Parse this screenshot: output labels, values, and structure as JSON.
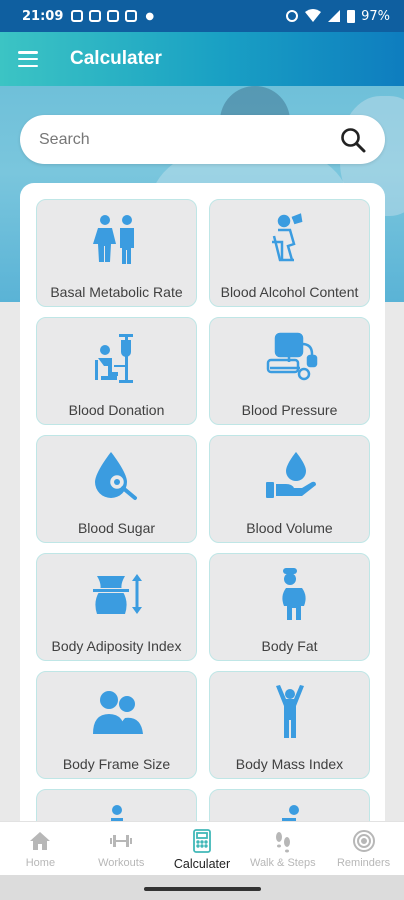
{
  "status_bar": {
    "time": "21:09",
    "battery": "97%"
  },
  "app_bar": {
    "title": "Calculater"
  },
  "search": {
    "placeholder": "Search"
  },
  "tiles": [
    {
      "label": "Basal Metabolic Rate",
      "icon": "couple-icon"
    },
    {
      "label": "Blood Alcohol Content",
      "icon": "drinking-person-icon"
    },
    {
      "label": "Blood Donation",
      "icon": "blood-donation-icon"
    },
    {
      "label": "Blood Pressure",
      "icon": "blood-pressure-monitor-icon"
    },
    {
      "label": "Blood Sugar",
      "icon": "blood-drop-search-icon"
    },
    {
      "label": "Blood Volume",
      "icon": "hand-drop-icon"
    },
    {
      "label": "Body Adiposity Index",
      "icon": "waist-measure-icon"
    },
    {
      "label": "Body Fat",
      "icon": "body-fat-person-icon"
    },
    {
      "label": "Body Frame Size",
      "icon": "two-persons-icon"
    },
    {
      "label": "Body Mass Index",
      "icon": "person-arms-up-icon"
    }
  ],
  "nav": {
    "items": [
      {
        "label": "Home",
        "icon": "home-icon"
      },
      {
        "label": "Workouts",
        "icon": "dumbbell-icon"
      },
      {
        "label": "Calculater",
        "icon": "calculator-icon",
        "active": true
      },
      {
        "label": "Walk & Steps",
        "icon": "footsteps-icon"
      },
      {
        "label": "Reminders",
        "icon": "target-icon"
      }
    ]
  },
  "colors": {
    "accent": "#3b9ce0",
    "header_start": "#3cc4c4",
    "header_end": "#0e7dbf",
    "tile_bg": "#e9e9ea"
  }
}
